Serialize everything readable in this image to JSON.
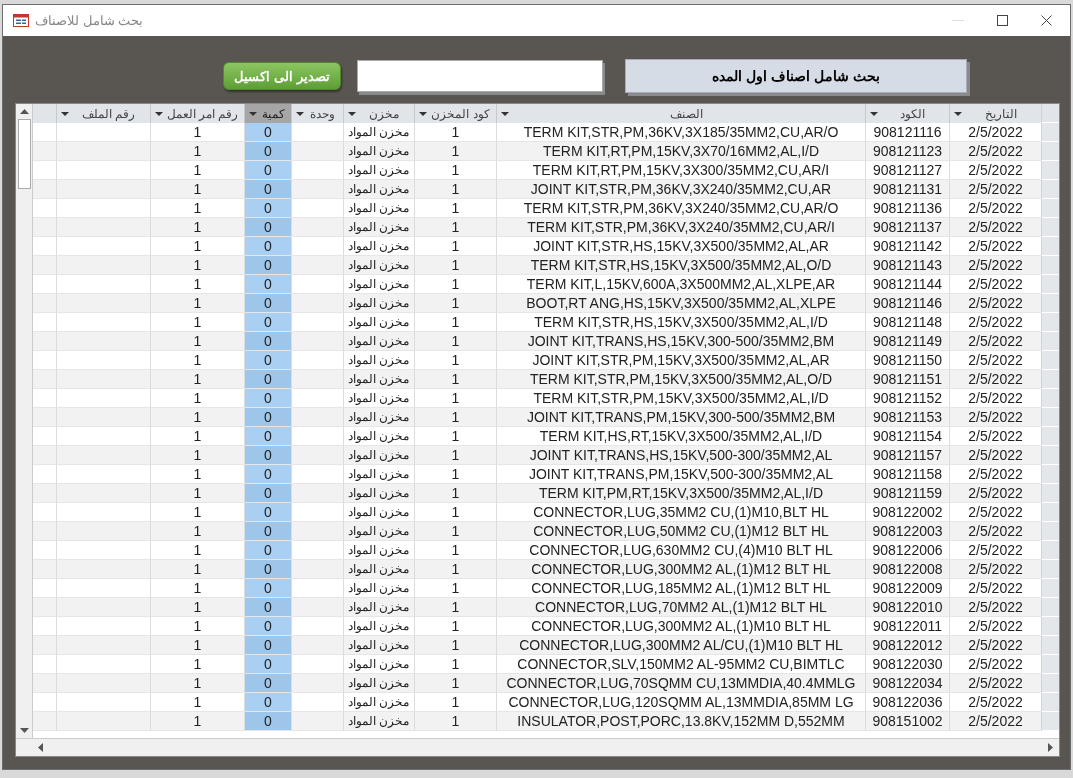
{
  "window": {
    "title": "بحث شامل للاصناف"
  },
  "toolbar": {
    "export_button": "تصدير الى اكسيل",
    "title_label": "بحث شامل اصناف اول المده"
  },
  "table": {
    "columns": [
      {
        "label": "التاريخ",
        "selected": false
      },
      {
        "label": "الكود",
        "selected": false
      },
      {
        "label": "الصنف",
        "selected": false
      },
      {
        "label": "كود المخزن",
        "selected": false
      },
      {
        "label": "مخزن",
        "selected": false
      },
      {
        "label": "وحدة",
        "selected": false
      },
      {
        "label": "كمية",
        "selected": true
      },
      {
        "label": "رقم امر العمل",
        "selected": false
      },
      {
        "label": "رقم الملف",
        "selected": false
      }
    ],
    "rows": [
      {
        "date": "2/5/2022",
        "code": "908121116",
        "item": "TERM KIT,STR,PM,36KV,3X185/35MM2,CU,AR/O",
        "store_code": "1",
        "store": "مخزن المواد",
        "qty": "0",
        "work_order": "1"
      },
      {
        "date": "2/5/2022",
        "code": "908121123",
        "item": "TERM KIT,RT,PM,15KV,3X70/16MM2,AL,I/D",
        "store_code": "1",
        "store": "مخزن المواد",
        "qty": "0",
        "work_order": "1"
      },
      {
        "date": "2/5/2022",
        "code": "908121127",
        "item": "TERM KIT,RT,PM,15KV,3X300/35MM2,CU,AR/I",
        "store_code": "1",
        "store": "مخزن المواد",
        "qty": "0",
        "work_order": "1"
      },
      {
        "date": "2/5/2022",
        "code": "908121131",
        "item": "JOINT KIT,STR,PM,36KV,3X240/35MM2,CU,AR",
        "store_code": "1",
        "store": "مخزن المواد",
        "qty": "0",
        "work_order": "1"
      },
      {
        "date": "2/5/2022",
        "code": "908121136",
        "item": "TERM KIT,STR,PM,36KV,3X240/35MM2,CU,AR/O",
        "store_code": "1",
        "store": "مخزن المواد",
        "qty": "0",
        "work_order": "1"
      },
      {
        "date": "2/5/2022",
        "code": "908121137",
        "item": "TERM KIT,STR,PM,36KV,3X240/35MM2,CU,AR/I",
        "store_code": "1",
        "store": "مخزن المواد",
        "qty": "0",
        "work_order": "1"
      },
      {
        "date": "2/5/2022",
        "code": "908121142",
        "item": "JOINT KIT,STR,HS,15KV,3X500/35MM2,AL,AR",
        "store_code": "1",
        "store": "مخزن المواد",
        "qty": "0",
        "work_order": "1"
      },
      {
        "date": "2/5/2022",
        "code": "908121143",
        "item": "TERM KIT,STR,HS,15KV,3X500/35MM2,AL,O/D",
        "store_code": "1",
        "store": "مخزن المواد",
        "qty": "0",
        "work_order": "1"
      },
      {
        "date": "2/5/2022",
        "code": "908121144",
        "item": "TERM KIT,L,15KV,600A,3X500MM2,AL,XLPE,AR",
        "store_code": "1",
        "store": "مخزن المواد",
        "qty": "0",
        "work_order": "1"
      },
      {
        "date": "2/5/2022",
        "code": "908121146",
        "item": "BOOT,RT ANG,HS,15KV,3X500/35MM2,AL,XLPE",
        "store_code": "1",
        "store": "مخزن المواد",
        "qty": "0",
        "work_order": "1"
      },
      {
        "date": "2/5/2022",
        "code": "908121148",
        "item": "TERM KIT,STR,HS,15KV,3X500/35MM2,AL,I/D",
        "store_code": "1",
        "store": "مخزن المواد",
        "qty": "0",
        "work_order": "1"
      },
      {
        "date": "2/5/2022",
        "code": "908121149",
        "item": "JOINT KIT,TRANS,HS,15KV,300-500/35MM2,BM",
        "store_code": "1",
        "store": "مخزن المواد",
        "qty": "0",
        "work_order": "1"
      },
      {
        "date": "2/5/2022",
        "code": "908121150",
        "item": "JOINT KIT,STR,PM,15KV,3X500/35MM2,AL,AR",
        "store_code": "1",
        "store": "مخزن المواد",
        "qty": "0",
        "work_order": "1"
      },
      {
        "date": "2/5/2022",
        "code": "908121151",
        "item": "TERM KIT,STR,PM,15KV,3X500/35MM2,AL,O/D",
        "store_code": "1",
        "store": "مخزن المواد",
        "qty": "0",
        "work_order": "1"
      },
      {
        "date": "2/5/2022",
        "code": "908121152",
        "item": "TERM KIT,STR,PM,15KV,3X500/35MM2,AL,I/D",
        "store_code": "1",
        "store": "مخزن المواد",
        "qty": "0",
        "work_order": "1"
      },
      {
        "date": "2/5/2022",
        "code": "908121153",
        "item": "JOINT KIT,TRANS,PM,15KV,300-500/35MM2,BM",
        "store_code": "1",
        "store": "مخزن المواد",
        "qty": "0",
        "work_order": "1"
      },
      {
        "date": "2/5/2022",
        "code": "908121154",
        "item": "TERM KIT,HS,RT,15KV,3X500/35MM2,AL,I/D",
        "store_code": "1",
        "store": "مخزن المواد",
        "qty": "0",
        "work_order": "1"
      },
      {
        "date": "2/5/2022",
        "code": "908121157",
        "item": "JOINT KIT,TRANS,HS,15KV,500-300/35MM2,AL",
        "store_code": "1",
        "store": "مخزن المواد",
        "qty": "0",
        "work_order": "1"
      },
      {
        "date": "2/5/2022",
        "code": "908121158",
        "item": "JOINT KIT,TRANS,PM,15KV,500-300/35MM2,AL",
        "store_code": "1",
        "store": "مخزن المواد",
        "qty": "0",
        "work_order": "1"
      },
      {
        "date": "2/5/2022",
        "code": "908121159",
        "item": "TERM KIT,PM,RT,15KV,3X500/35MM2,AL,I/D",
        "store_code": "1",
        "store": "مخزن المواد",
        "qty": "0",
        "work_order": "1"
      },
      {
        "date": "2/5/2022",
        "code": "908122002",
        "item": "CONNECTOR,LUG,35MM2 CU,(1)M10,BLT HL",
        "store_code": "1",
        "store": "مخزن المواد",
        "qty": "0",
        "work_order": "1"
      },
      {
        "date": "2/5/2022",
        "code": "908122003",
        "item": "CONNECTOR,LUG,50MM2 CU,(1)M12 BLT HL",
        "store_code": "1",
        "store": "مخزن المواد",
        "qty": "0",
        "work_order": "1"
      },
      {
        "date": "2/5/2022",
        "code": "908122006",
        "item": "CONNECTOR,LUG,630MM2 CU,(4)M10 BLT HL",
        "store_code": "1",
        "store": "مخزن المواد",
        "qty": "0",
        "work_order": "1"
      },
      {
        "date": "2/5/2022",
        "code": "908122008",
        "item": "CONNECTOR,LUG,300MM2 AL,(1)M12 BLT HL",
        "store_code": "1",
        "store": "مخزن المواد",
        "qty": "0",
        "work_order": "1"
      },
      {
        "date": "2/5/2022",
        "code": "908122009",
        "item": "CONNECTOR,LUG,185MM2 AL,(1)M12 BLT HL",
        "store_code": "1",
        "store": "مخزن المواد",
        "qty": "0",
        "work_order": "1"
      },
      {
        "date": "2/5/2022",
        "code": "908122010",
        "item": "CONNECTOR,LUG,70MM2 AL,(1)M12 BLT HL",
        "store_code": "1",
        "store": "مخزن المواد",
        "qty": "0",
        "work_order": "1"
      },
      {
        "date": "2/5/2022",
        "code": "908122011",
        "item": "CONNECTOR,LUG,300MM2 AL,(1)M10 BLT HL",
        "store_code": "1",
        "store": "مخزن المواد",
        "qty": "0",
        "work_order": "1"
      },
      {
        "date": "2/5/2022",
        "code": "908122012",
        "item": "CONNECTOR,LUG,300MM2 AL/CU,(1)M10 BLT HL",
        "store_code": "1",
        "store": "مخزن المواد",
        "qty": "0",
        "work_order": "1"
      },
      {
        "date": "2/5/2022",
        "code": "908122030",
        "item": "CONNECTOR,SLV,150MM2 AL-95MM2 CU,BIMTLC",
        "store_code": "1",
        "store": "مخزن المواد",
        "qty": "0",
        "work_order": "1"
      },
      {
        "date": "2/5/2022",
        "code": "908122034",
        "item": "CONNECTOR,LUG,70SQMM CU,13MMDIA,40.4MMLG",
        "store_code": "1",
        "store": "مخزن المواد",
        "qty": "0",
        "work_order": "1"
      },
      {
        "date": "2/5/2022",
        "code": "908122036",
        "item": "CONNECTOR,LUG,120SQMM AL,13MMDIA,85MM LG",
        "store_code": "1",
        "store": "مخزن المواد",
        "qty": "0",
        "work_order": "1"
      },
      {
        "date": "2/5/2022",
        "code": "908151002",
        "item": "INSULATOR,POST,PORC,13.8KV,152MM D,552MM",
        "store_code": "1",
        "store": "مخزن المواد",
        "qty": "0",
        "work_order": "1"
      }
    ]
  }
}
